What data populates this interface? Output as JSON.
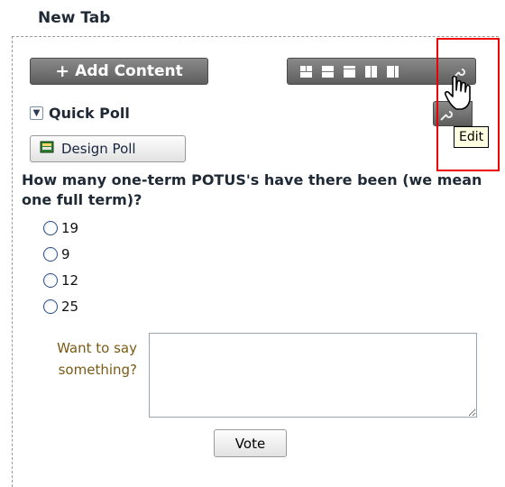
{
  "tab": {
    "title": "New Tab"
  },
  "toolbar": {
    "add_content_label": "Add Content"
  },
  "layout_icons": [
    "layout-1-icon",
    "layout-2-icon",
    "layout-3-icon",
    "layout-4-icon",
    "layout-5-icon",
    "edit-wrench-icon"
  ],
  "portlet": {
    "title": "Quick Poll",
    "design_button": "Design Poll"
  },
  "poll": {
    "question": "How many one-term POTUS's have there been (we mean one full term)?",
    "options": [
      "19",
      "9",
      "12",
      "25"
    ],
    "comment_label": "Want to say something?",
    "vote_label": "Vote"
  },
  "tooltip": {
    "text": "Edit"
  },
  "colors": {
    "highlight": "#e00000",
    "toolbar": "#6f6f6f",
    "label_brown": "#7a5a14"
  }
}
